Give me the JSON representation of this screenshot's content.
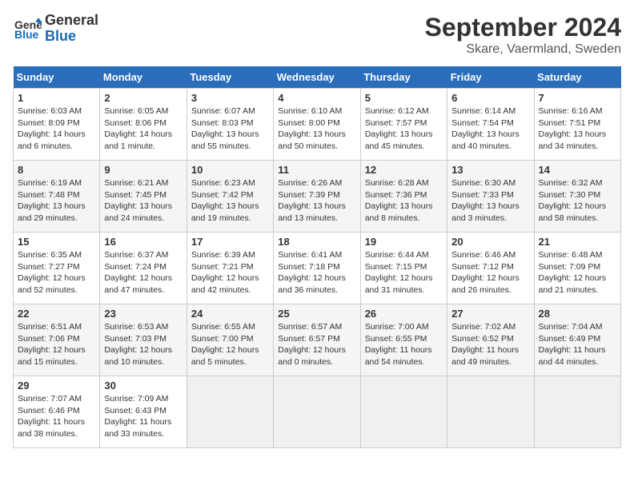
{
  "header": {
    "logo_line1": "General",
    "logo_line2": "Blue",
    "month": "September 2024",
    "location": "Skare, Vaermland, Sweden"
  },
  "days_of_week": [
    "Sunday",
    "Monday",
    "Tuesday",
    "Wednesday",
    "Thursday",
    "Friday",
    "Saturday"
  ],
  "weeks": [
    [
      {
        "day": "1",
        "sunrise": "6:03 AM",
        "sunset": "8:09 PM",
        "daylight": "14 hours and 6 minutes."
      },
      {
        "day": "2",
        "sunrise": "6:05 AM",
        "sunset": "8:06 PM",
        "daylight": "14 hours and 1 minute."
      },
      {
        "day": "3",
        "sunrise": "6:07 AM",
        "sunset": "8:03 PM",
        "daylight": "13 hours and 55 minutes."
      },
      {
        "day": "4",
        "sunrise": "6:10 AM",
        "sunset": "8:00 PM",
        "daylight": "13 hours and 50 minutes."
      },
      {
        "day": "5",
        "sunrise": "6:12 AM",
        "sunset": "7:57 PM",
        "daylight": "13 hours and 45 minutes."
      },
      {
        "day": "6",
        "sunrise": "6:14 AM",
        "sunset": "7:54 PM",
        "daylight": "13 hours and 40 minutes."
      },
      {
        "day": "7",
        "sunrise": "6:16 AM",
        "sunset": "7:51 PM",
        "daylight": "13 hours and 34 minutes."
      }
    ],
    [
      {
        "day": "8",
        "sunrise": "6:19 AM",
        "sunset": "7:48 PM",
        "daylight": "13 hours and 29 minutes."
      },
      {
        "day": "9",
        "sunrise": "6:21 AM",
        "sunset": "7:45 PM",
        "daylight": "13 hours and 24 minutes."
      },
      {
        "day": "10",
        "sunrise": "6:23 AM",
        "sunset": "7:42 PM",
        "daylight": "13 hours and 19 minutes."
      },
      {
        "day": "11",
        "sunrise": "6:26 AM",
        "sunset": "7:39 PM",
        "daylight": "13 hours and 13 minutes."
      },
      {
        "day": "12",
        "sunrise": "6:28 AM",
        "sunset": "7:36 PM",
        "daylight": "13 hours and 8 minutes."
      },
      {
        "day": "13",
        "sunrise": "6:30 AM",
        "sunset": "7:33 PM",
        "daylight": "13 hours and 3 minutes."
      },
      {
        "day": "14",
        "sunrise": "6:32 AM",
        "sunset": "7:30 PM",
        "daylight": "12 hours and 58 minutes."
      }
    ],
    [
      {
        "day": "15",
        "sunrise": "6:35 AM",
        "sunset": "7:27 PM",
        "daylight": "12 hours and 52 minutes."
      },
      {
        "day": "16",
        "sunrise": "6:37 AM",
        "sunset": "7:24 PM",
        "daylight": "12 hours and 47 minutes."
      },
      {
        "day": "17",
        "sunrise": "6:39 AM",
        "sunset": "7:21 PM",
        "daylight": "12 hours and 42 minutes."
      },
      {
        "day": "18",
        "sunrise": "6:41 AM",
        "sunset": "7:18 PM",
        "daylight": "12 hours and 36 minutes."
      },
      {
        "day": "19",
        "sunrise": "6:44 AM",
        "sunset": "7:15 PM",
        "daylight": "12 hours and 31 minutes."
      },
      {
        "day": "20",
        "sunrise": "6:46 AM",
        "sunset": "7:12 PM",
        "daylight": "12 hours and 26 minutes."
      },
      {
        "day": "21",
        "sunrise": "6:48 AM",
        "sunset": "7:09 PM",
        "daylight": "12 hours and 21 minutes."
      }
    ],
    [
      {
        "day": "22",
        "sunrise": "6:51 AM",
        "sunset": "7:06 PM",
        "daylight": "12 hours and 15 minutes."
      },
      {
        "day": "23",
        "sunrise": "6:53 AM",
        "sunset": "7:03 PM",
        "daylight": "12 hours and 10 minutes."
      },
      {
        "day": "24",
        "sunrise": "6:55 AM",
        "sunset": "7:00 PM",
        "daylight": "12 hours and 5 minutes."
      },
      {
        "day": "25",
        "sunrise": "6:57 AM",
        "sunset": "6:57 PM",
        "daylight": "12 hours and 0 minutes."
      },
      {
        "day": "26",
        "sunrise": "7:00 AM",
        "sunset": "6:55 PM",
        "daylight": "11 hours and 54 minutes."
      },
      {
        "day": "27",
        "sunrise": "7:02 AM",
        "sunset": "6:52 PM",
        "daylight": "11 hours and 49 minutes."
      },
      {
        "day": "28",
        "sunrise": "7:04 AM",
        "sunset": "6:49 PM",
        "daylight": "11 hours and 44 minutes."
      }
    ],
    [
      {
        "day": "29",
        "sunrise": "7:07 AM",
        "sunset": "6:46 PM",
        "daylight": "11 hours and 38 minutes."
      },
      {
        "day": "30",
        "sunrise": "7:09 AM",
        "sunset": "6:43 PM",
        "daylight": "11 hours and 33 minutes."
      },
      null,
      null,
      null,
      null,
      null
    ]
  ]
}
